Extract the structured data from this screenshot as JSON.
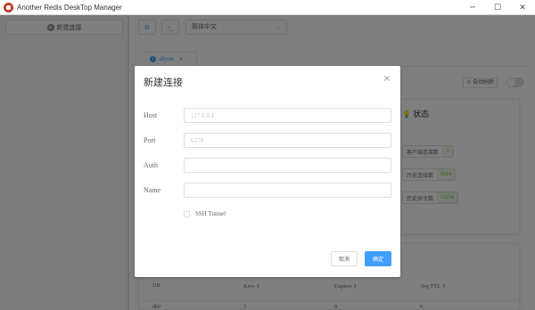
{
  "window": {
    "title": "Another Redis DeskTop Manager",
    "min_glyph": "─",
    "max_glyph": "☐",
    "close_glyph": "✕"
  },
  "sidebar": {
    "new_connection_label": "新建连接",
    "new_connection_icon": "+"
  },
  "toolbar": {
    "settings_glyph": "⚙",
    "code_glyph": "›_",
    "language": "简体中文",
    "language_caret": "⌄"
  },
  "tabs": [
    {
      "label": "aliyun",
      "icon": "ⓘ",
      "close": "×"
    }
  ],
  "status": {
    "auto_refresh_label": "⟳ 自动刷新",
    "title": "状态",
    "title_icon": "💡",
    "rows": [
      {
        "label": "客户端连接数",
        "value": "1"
      },
      {
        "label": "历史连接数",
        "value": "5614"
      },
      {
        "label": "历史命令数",
        "value": "15234"
      }
    ]
  },
  "keyspace_table": {
    "headers": [
      "DB",
      "Keys ⇕",
      "Expires ⇕",
      "Avg TTL ⇕"
    ],
    "rows": [
      [
        "db0",
        "3",
        "0",
        "0"
      ]
    ]
  },
  "dialog": {
    "title": "新建连接",
    "close_glyph": "×",
    "fields": {
      "host": {
        "label": "Host",
        "placeholder": "127.0.0.1",
        "value": ""
      },
      "port": {
        "label": "Port",
        "placeholder": "6379",
        "value": ""
      },
      "auth": {
        "label": "Auth",
        "placeholder": "",
        "value": ""
      },
      "name": {
        "label": "Name",
        "placeholder": "",
        "value": ""
      }
    },
    "ssh_tunnel_label": "SSH Tunnel",
    "cancel_label": "取消",
    "ok_label": "确定"
  },
  "colors": {
    "primary": "#409eff",
    "overlay": "rgba(0,0,0,0.5)",
    "app_logo": "#c0392b",
    "stat_value": "#67c23a"
  }
}
